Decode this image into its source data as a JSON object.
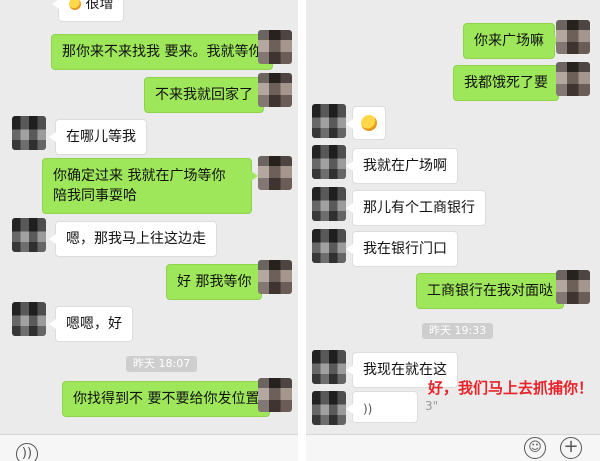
{
  "left_chat": {
    "top_partial_text": "很增",
    "messages": [
      {
        "sender": "me",
        "text": "那你来不来找我 要来。我就等你"
      },
      {
        "sender": "me",
        "text": "不来我就回家了"
      },
      {
        "sender": "other",
        "text": "在哪儿等我"
      },
      {
        "sender": "me",
        "text": "你确定过来 我就在广场等你 陪我同事耍哈"
      },
      {
        "sender": "other",
        "text": "嗯，那我马上往这边走"
      },
      {
        "sender": "me",
        "text": "好 那我等你"
      },
      {
        "sender": "other",
        "text": "嗯嗯，好"
      },
      {
        "sender": "me",
        "text": "你找得到不 要不要给你发位置"
      }
    ],
    "timestamp": "昨天 18:07"
  },
  "right_chat": {
    "messages": [
      {
        "sender": "me",
        "text": "你来广场嘛"
      },
      {
        "sender": "me",
        "text": "我都饿死了要"
      },
      {
        "sender": "other",
        "emoji": "smiley-emoji"
      },
      {
        "sender": "other",
        "text": "我就在广场啊"
      },
      {
        "sender": "other",
        "text": "那儿有个工商银行"
      },
      {
        "sender": "other",
        "text": "我在银行门口"
      },
      {
        "sender": "me",
        "text": "工商银行在我对面哒"
      },
      {
        "sender": "other",
        "text": "我现在就在这"
      },
      {
        "sender": "other",
        "voice_duration": "3\""
      }
    ],
    "timestamp": "昨天 19:33"
  },
  "annotation": "好，我们马上去抓捕你！",
  "icons": {
    "voice": "voice-icon",
    "emoji": "emoji-icon",
    "plus": "plus-icon"
  },
  "colors": {
    "green_bubble": "#9fe75a",
    "chat_background": "#ebebeb",
    "annotation": "#e8232a"
  }
}
